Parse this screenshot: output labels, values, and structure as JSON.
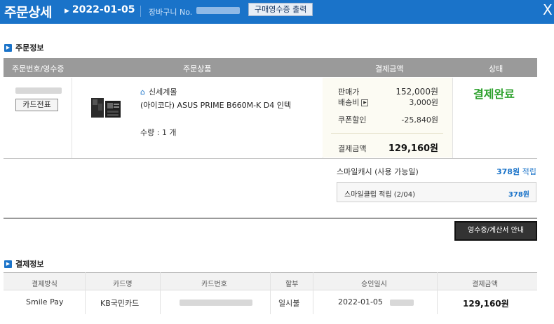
{
  "header": {
    "title": "주문상세",
    "date": "2022-01-05",
    "basket_label": "장바구니 No.",
    "receipt_print_button": "구매영수증 출력",
    "close_label": "X"
  },
  "order_info": {
    "section_title": "주문정보",
    "columns": [
      "주문번호/영수증",
      "주문상품",
      "결제금액",
      "상태"
    ],
    "card_slip_button": "카드전표",
    "store_name": "신세계몰",
    "product_name": "(아이코다) ASUS PRIME B660M-K D4 인텍",
    "quantity": "수량 : 1 개",
    "payment": {
      "sale_price_label": "판매가",
      "sale_price": "152,000원",
      "shipping_label": "배송비",
      "shipping": "3,000원",
      "coupon_label": "쿠폰할인",
      "coupon": "-25,840원",
      "total_label": "결제금액",
      "total": "129,160원"
    },
    "status": "결제완료",
    "smile_cash_label": "스마일캐시 (사용 가능일)",
    "smile_cash_amount": "378원",
    "smile_cash_suffix": "적립",
    "smile_club_label": "스마일클럽 적립 (2/04)",
    "smile_club_amount": "378원",
    "receipt_info_button": "영수증/계산서 안내"
  },
  "payment_info": {
    "section_title": "결제정보",
    "columns": [
      "결제방식",
      "카드명",
      "카드번호",
      "할부",
      "승인일시",
      "결제금액"
    ],
    "row": {
      "method": "Smile Pay",
      "card_name": "KB국민카드",
      "installment": "일시불",
      "approval_date": "2022-01-05",
      "amount": "129,160원"
    }
  },
  "colors": {
    "header_bg": "#1a73c9",
    "status_green": "#2da12d",
    "link_blue": "#1a73c9"
  }
}
